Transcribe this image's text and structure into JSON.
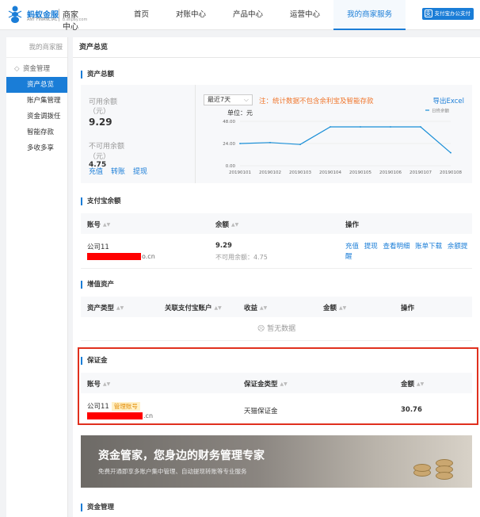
{
  "header": {
    "brand": "蚂蚁金服",
    "brand_sub": "ANT FINANCIAL",
    "merchant": "商家中心",
    "merchant_sub": "b.alipay.com",
    "nav": [
      "首页",
      "对账中心",
      "产品中心",
      "运营中心",
      "我的商家服务"
    ],
    "alipay_office": "支付宝办公支付"
  },
  "sidebar": {
    "head": "我的商家服",
    "group": "资金管理",
    "items": [
      "资产总览",
      "账户集管理",
      "资金调拨任",
      "智能存款",
      "多收多享"
    ]
  },
  "page": {
    "title": "资产总览",
    "overview": {
      "title": "资产总额",
      "available_label": "可用余额",
      "yuan": "（元）",
      "available_value": "9.29",
      "unavailable_label": "不可用余额",
      "unavailable_value": "4.75",
      "actions": [
        "充值",
        "转账",
        "提现"
      ],
      "range": "最近7天",
      "note": "注：统计数据不包含余利宝及智能存款",
      "export": "导出Excel",
      "unit": "单位：元",
      "legend": "日终余额"
    },
    "alipay": {
      "title": "支付宝余额",
      "headers": [
        "账号",
        "余额",
        "操作"
      ],
      "account_name": "公司11",
      "account_tail": "o.cn",
      "balance": "9.29",
      "unavailable": "不可用余额：4.75",
      "ops": [
        "充值",
        "提现",
        "查看明细",
        "账单下载",
        "余额提醒"
      ]
    },
    "value_added": {
      "title": "增值资产",
      "headers": [
        "资产类型",
        "关联支付宝账户",
        "收益",
        "金额",
        "操作"
      ],
      "empty": "暂无数据"
    },
    "deposit": {
      "title": "保证金",
      "headers": [
        "账号",
        "保证金类型",
        "金额"
      ],
      "account_name": "公司11",
      "badge": "管理账号",
      "account_tail": ".cn",
      "type": "天猫保证金",
      "amount": "30.76"
    },
    "banner": {
      "main": "资金管家，您身边的财务管理专家",
      "sub": "免费开通即享多账户集中管理、自动提现转账等专业服务"
    },
    "fund_mgmt_title": "资金管理"
  },
  "chart_data": {
    "type": "line",
    "x": [
      "20190101",
      "20190102",
      "20190103",
      "20190104",
      "20190105",
      "20190106",
      "20190107",
      "20190108"
    ],
    "series": [
      {
        "name": "日终余额",
        "values": [
          24,
          25,
          23,
          42,
          42,
          42,
          42,
          14
        ]
      }
    ],
    "yticks": [
      "48.00",
      "24.00",
      "0.00"
    ],
    "ylim": [
      0,
      48
    ],
    "ylabel": "单位：元",
    "grid": true,
    "legend": "top-right",
    "color": "#1a8fd7"
  }
}
